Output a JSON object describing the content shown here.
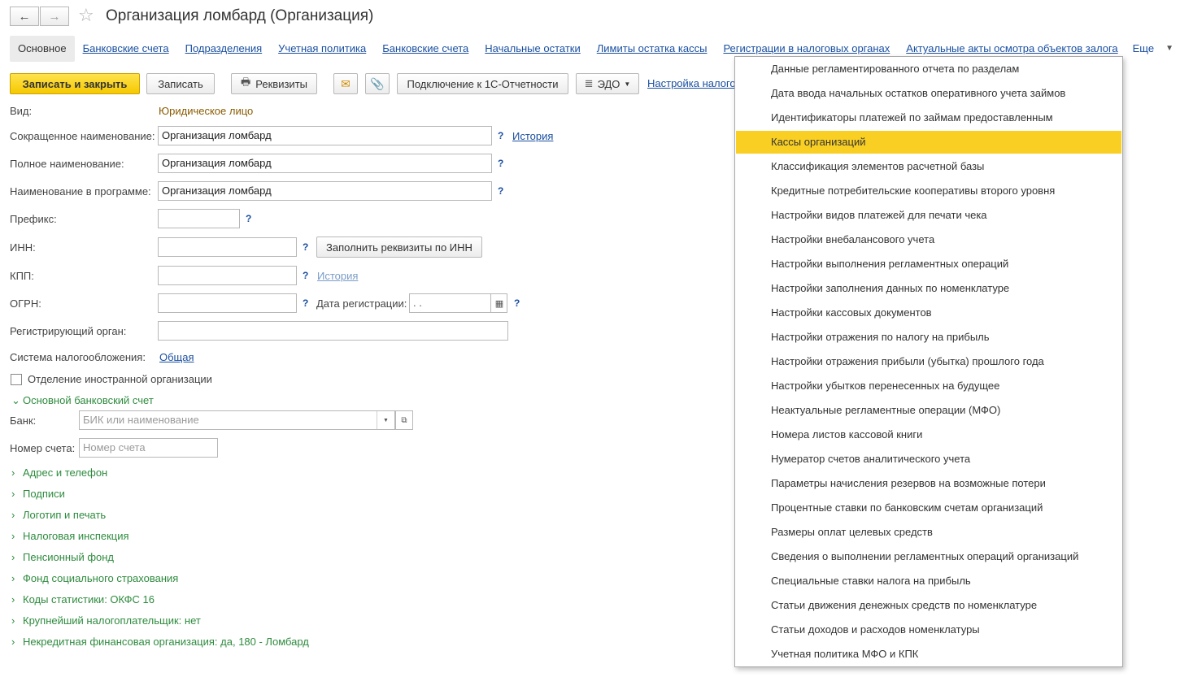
{
  "window": {
    "title": "Организация ломбард (Организация)",
    "back_icon": "←",
    "forward_icon": "→",
    "star_icon": "☆"
  },
  "tabs": [
    {
      "label": "Основное",
      "active": true
    },
    {
      "label": "Банковские счета"
    },
    {
      "label": "Подразделения"
    },
    {
      "label": "Учетная политика"
    },
    {
      "label": "Банковские счета"
    },
    {
      "label": "Начальные остатки"
    },
    {
      "label": "Лимиты остатка кассы"
    },
    {
      "label": "Регистрации в налоговых органах"
    },
    {
      "label": "Актуальные акты осмотра объектов залога"
    }
  ],
  "tabs_more": "Еще",
  "toolbar": {
    "save_close": "Записать и закрыть",
    "save": "Записать",
    "requisites": "Реквизиты",
    "connect": "Подключение к 1С-Отчетности",
    "edo": "ЭДО",
    "tax_settings": "Настройка налого"
  },
  "form": {
    "vid_label": "Вид:",
    "vid_value": "Юридическое лицо",
    "short_name_label": "Сокращенное наименование:",
    "short_name_value": "Организация ломбард",
    "full_name_label": "Полное наименование:",
    "full_name_value": "Организация ломбард",
    "program_name_label": "Наименование в программе:",
    "program_name_value": "Организация ломбард",
    "prefix_label": "Префикс:",
    "inn_label": "ИНН:",
    "fill_by_inn": "Заполнить реквизиты по ИНН",
    "kpp_label": "КПП:",
    "ogrn_label": "ОГРН:",
    "reg_date_label": "Дата регистрации:",
    "reg_date_value": " .  .",
    "reg_organ_label": "Регистрирующий орган:",
    "tax_system_label": "Система налогообложения:",
    "tax_system_value": "Общая",
    "foreign_branch_label": "Отделение иностранной организации",
    "history": "История",
    "help": "?"
  },
  "bank_section": {
    "title": "Основной банковский счет",
    "bank_label": "Банк:",
    "bank_placeholder": "БИК или наименование",
    "account_label": "Номер счета:",
    "account_placeholder": "Номер счета"
  },
  "groups": [
    "Адрес и телефон",
    "Подписи",
    "Логотип и печать",
    "Налоговая инспекция",
    "Пенсионный фонд",
    "Фонд социального страхования",
    "Коды статистики: ОКФС 16",
    "Крупнейший налогоплательщик: нет",
    "Некредитная финансовая организация: да, 180 - Ломбард"
  ],
  "menu": {
    "selected_index": 3,
    "items": [
      "Данные регламентированного отчета по разделам",
      "Дата ввода начальных остатков оперативного учета займов",
      "Идентификаторы платежей по займам предоставленным",
      "Кассы организаций",
      "Классификация элементов расчетной базы",
      "Кредитные потребительские кооперативы второго уровня",
      "Настройки видов платежей для печати чека",
      "Настройки внебалансового учета",
      "Настройки выполнения регламентных операций",
      "Настройки заполнения данных по номенклатуре",
      "Настройки кассовых документов",
      "Настройки отражения по налогу на прибыль",
      "Настройки отражения прибыли (убытка) прошлого года",
      "Настройки убытков перенесенных на будущее",
      "Неактуальные регламентные операции (МФО)",
      "Номера листов кассовой книги",
      "Нумератор счетов аналитического учета",
      "Параметры начисления резервов на возможные потери",
      "Процентные ставки по банковским счетам организаций",
      "Размеры оплат целевых средств",
      "Сведения о выполнении регламентных операций организаций",
      "Специальные ставки налога на прибыль",
      "Статьи движения денежных средств по номенклатуре",
      "Статьи доходов и расходов номенклатуры",
      "Учетная политика МФО и КПК"
    ]
  },
  "colors": {
    "accent": "#f9cf24",
    "link": "#1a4fa0",
    "group": "#2e8b3e",
    "value": "#8a5a00"
  }
}
